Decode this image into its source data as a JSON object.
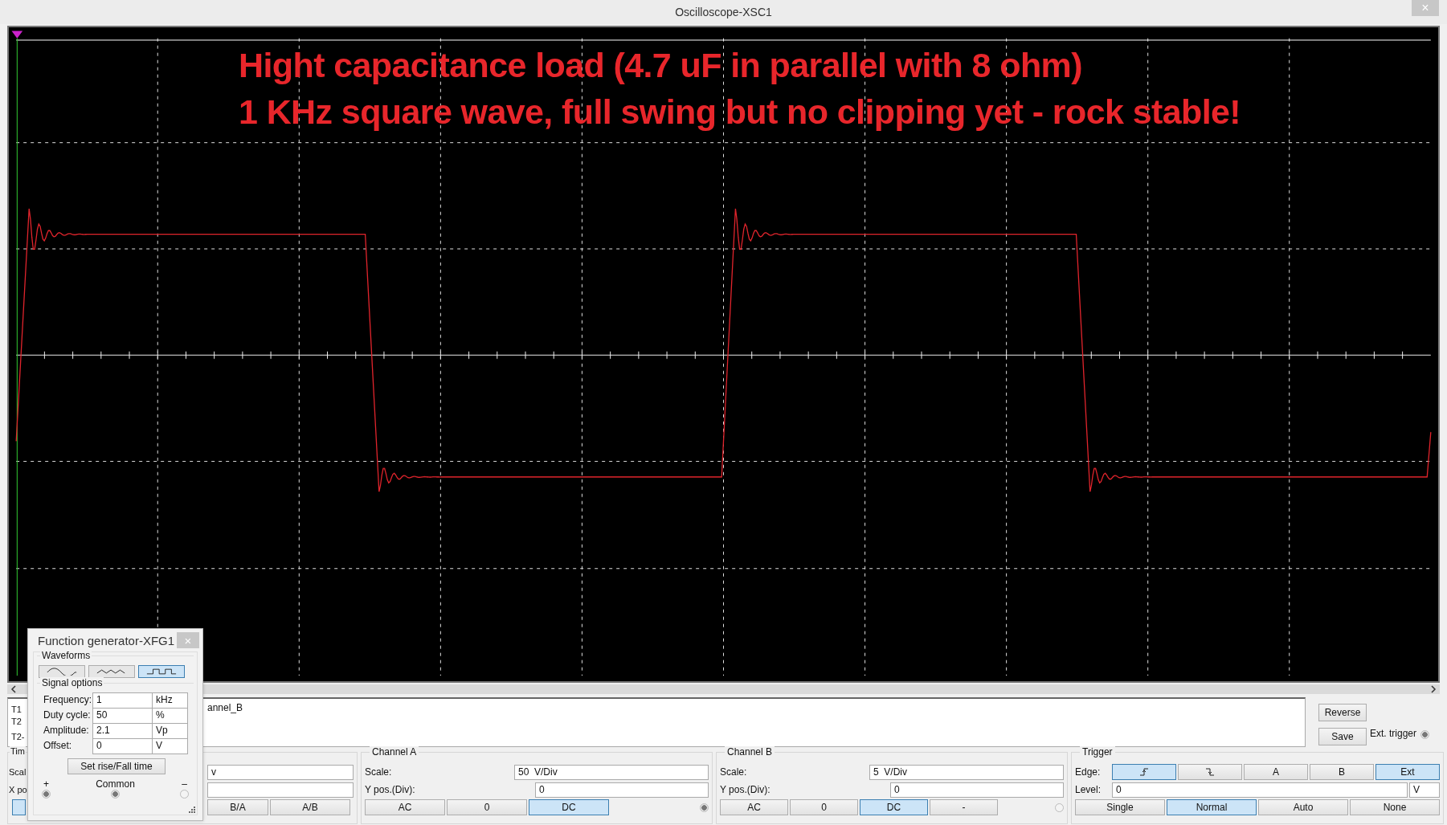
{
  "window": {
    "title": "Oscilloscope-XSC1",
    "close": "×"
  },
  "screen": {
    "annotation_lines": [
      "Hight capacitance load (4.7 uF in parallel with 8 ohm)",
      "1 KHz square wave, full swing but no clipping yet - rock stable!"
    ]
  },
  "readout": {
    "row_labels": [
      "T1",
      "T2",
      "T2-"
    ],
    "column_header": "annel_B",
    "buttons": [
      "Reverse",
      "Save"
    ],
    "ext_trigger": {
      "label": "Ext. trigger",
      "connected": true
    }
  },
  "timebase": {
    "legend": "Tim",
    "scale_label": "Scal",
    "xpos_label": "X po",
    "scale_value": "v",
    "buttons": [
      {
        "selected": true
      },
      {
        "label": "B/A",
        "selected": false
      },
      {
        "label": "A/B",
        "selected": false
      }
    ]
  },
  "channel_a": {
    "legend": "Channel A",
    "scale_label": "Scale:",
    "scale_value": "50  V/Div",
    "ypos_label": "Y pos.(Div):",
    "ypos_value": "0",
    "connected": true,
    "coupling": [
      {
        "label": "AC",
        "selected": false
      },
      {
        "label": "0",
        "selected": false
      },
      {
        "label": "DC",
        "selected": true
      }
    ]
  },
  "channel_b": {
    "legend": "Channel B",
    "scale_label": "Scale:",
    "scale_value": "5  V/Div",
    "ypos_label": "Y pos.(Div):",
    "ypos_value": "0",
    "connected": false,
    "coupling": [
      {
        "label": "AC",
        "selected": false
      },
      {
        "label": "0",
        "selected": false
      },
      {
        "label": "DC",
        "selected": true
      },
      {
        "label": "-",
        "selected": false
      }
    ]
  },
  "trigger": {
    "legend": "Trigger",
    "edge_label": "Edge:",
    "level_label": "Level:",
    "level_value": "0",
    "level_unit": "V",
    "edges": [
      {
        "kind": "rising",
        "selected": true
      },
      {
        "kind": "falling",
        "selected": false
      },
      {
        "kind": "text",
        "label": "A",
        "selected": false
      },
      {
        "kind": "text",
        "label": "B",
        "selected": false
      },
      {
        "kind": "text",
        "label": "Ext",
        "selected": true
      }
    ],
    "modes": [
      {
        "label": "Single",
        "selected": false
      },
      {
        "label": "Normal",
        "selected": true
      },
      {
        "label": "Auto",
        "selected": false
      },
      {
        "label": "None",
        "selected": false
      }
    ]
  },
  "function_generator": {
    "title": "Function generator-XFG1",
    "close": "×",
    "waveforms_legend": "Waveforms",
    "waveforms": [
      {
        "kind": "sine",
        "selected": false
      },
      {
        "kind": "triangle",
        "selected": false
      },
      {
        "kind": "square",
        "selected": true
      }
    ],
    "signal_legend": "Signal options",
    "fields": [
      {
        "label": "Frequency:",
        "value": "1",
        "unit": "kHz"
      },
      {
        "label": "Duty cycle:",
        "value": "50",
        "unit": "%"
      },
      {
        "label": "Amplitude:",
        "value": "2.1",
        "unit": "Vp"
      },
      {
        "label": "Offset:",
        "value": "0",
        "unit": "V"
      }
    ],
    "rise_fall_button": "Set rise/Fall time",
    "terminals": [
      {
        "label": "+",
        "connected": true
      },
      {
        "label": "Common",
        "connected": true
      },
      {
        "label": "–",
        "connected": false
      }
    ]
  }
}
